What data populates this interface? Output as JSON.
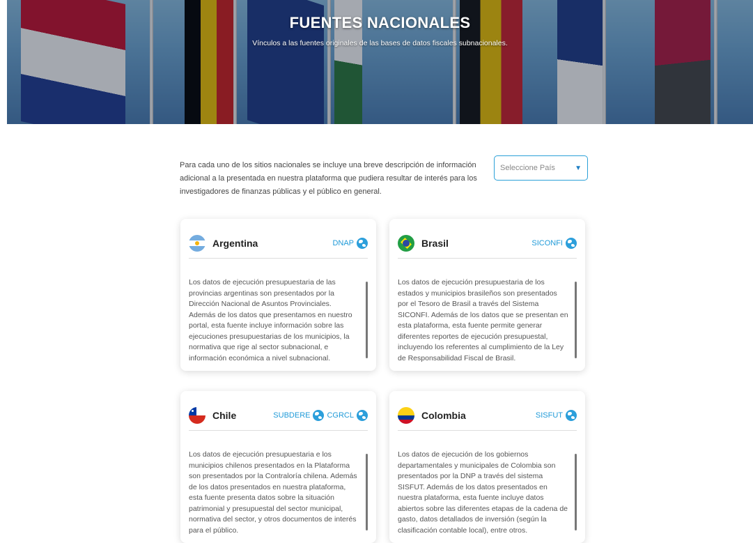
{
  "hero": {
    "title": "FUENTES NACIONALES",
    "subtitle": "Vínculos a las fuentes originales de las bases de datos fiscales subnacionales."
  },
  "intro": {
    "text": "Para cada uno de los sitios nacionales se incluye una breve descripción de información adicional a la presentada en nuestra plataforma que pudiera resultar de interés para los investigadores de finanzas públicas y el público en general."
  },
  "country_select": {
    "placeholder": "Seleccione País",
    "caret": "▼"
  },
  "colors": {
    "accent": "#1f9ad8",
    "select_border": "#2aa0d8"
  },
  "cards": [
    {
      "country": "Argentina",
      "flag_icon": "argentina-flag-icon",
      "links": [
        "DNAP"
      ],
      "description": "Los datos de ejecución presupuestaria de las provincias argentinas son presentados por la Dirección Nacional de Asuntos Provinciales. Además de los datos que presentamos en nuestro portal, esta fuente incluye información sobre las ejecuciones presupuestarias de los municipios, la normativa que rige al sector subnacional, e información económica a nivel subnacional."
    },
    {
      "country": "Brasil",
      "flag_icon": "brazil-flag-icon",
      "links": [
        "SICONFI"
      ],
      "description": "Los datos de ejecución presupuestaria de los estados y municipios brasileños son presentados por el Tesoro de Brasil a través del Sistema SICONFI. Además de los datos que se presentan en esta plataforma, esta fuente permite generar diferentes reportes de ejecución presupuestal, incluyendo los referentes al cumplimiento de la Ley de Responsabilidad Fiscal de Brasil."
    },
    {
      "country": "Chile",
      "flag_icon": "chile-flag-icon",
      "links": [
        "SUBDERE",
        "CGRCL"
      ],
      "description": "Los datos de ejecución presupuestaria e los municipios chilenos presentados en la Plataforma son presentados por la Contraloría chilena. Además de los datos presentados en nuestra plataforma, esta fuente presenta datos sobre la situación patrimonial y presupuestal del sector municipal, normativa del sector, y otros documentos de interés para el público."
    },
    {
      "country": "Colombia",
      "flag_icon": "colombia-flag-icon",
      "links": [
        "SISFUT"
      ],
      "description": "Los datos de ejecución de los gobiernos departamentales y municipales de Colombia son presentados por la DNP a través del sistema SISFUT. Además de los datos presentados en nuestra plataforma, esta fuente incluye datos abiertos sobre las diferentes etapas de la cadena de gasto, datos detallados de inversión (según la clasificación contable local), entre otros."
    }
  ]
}
